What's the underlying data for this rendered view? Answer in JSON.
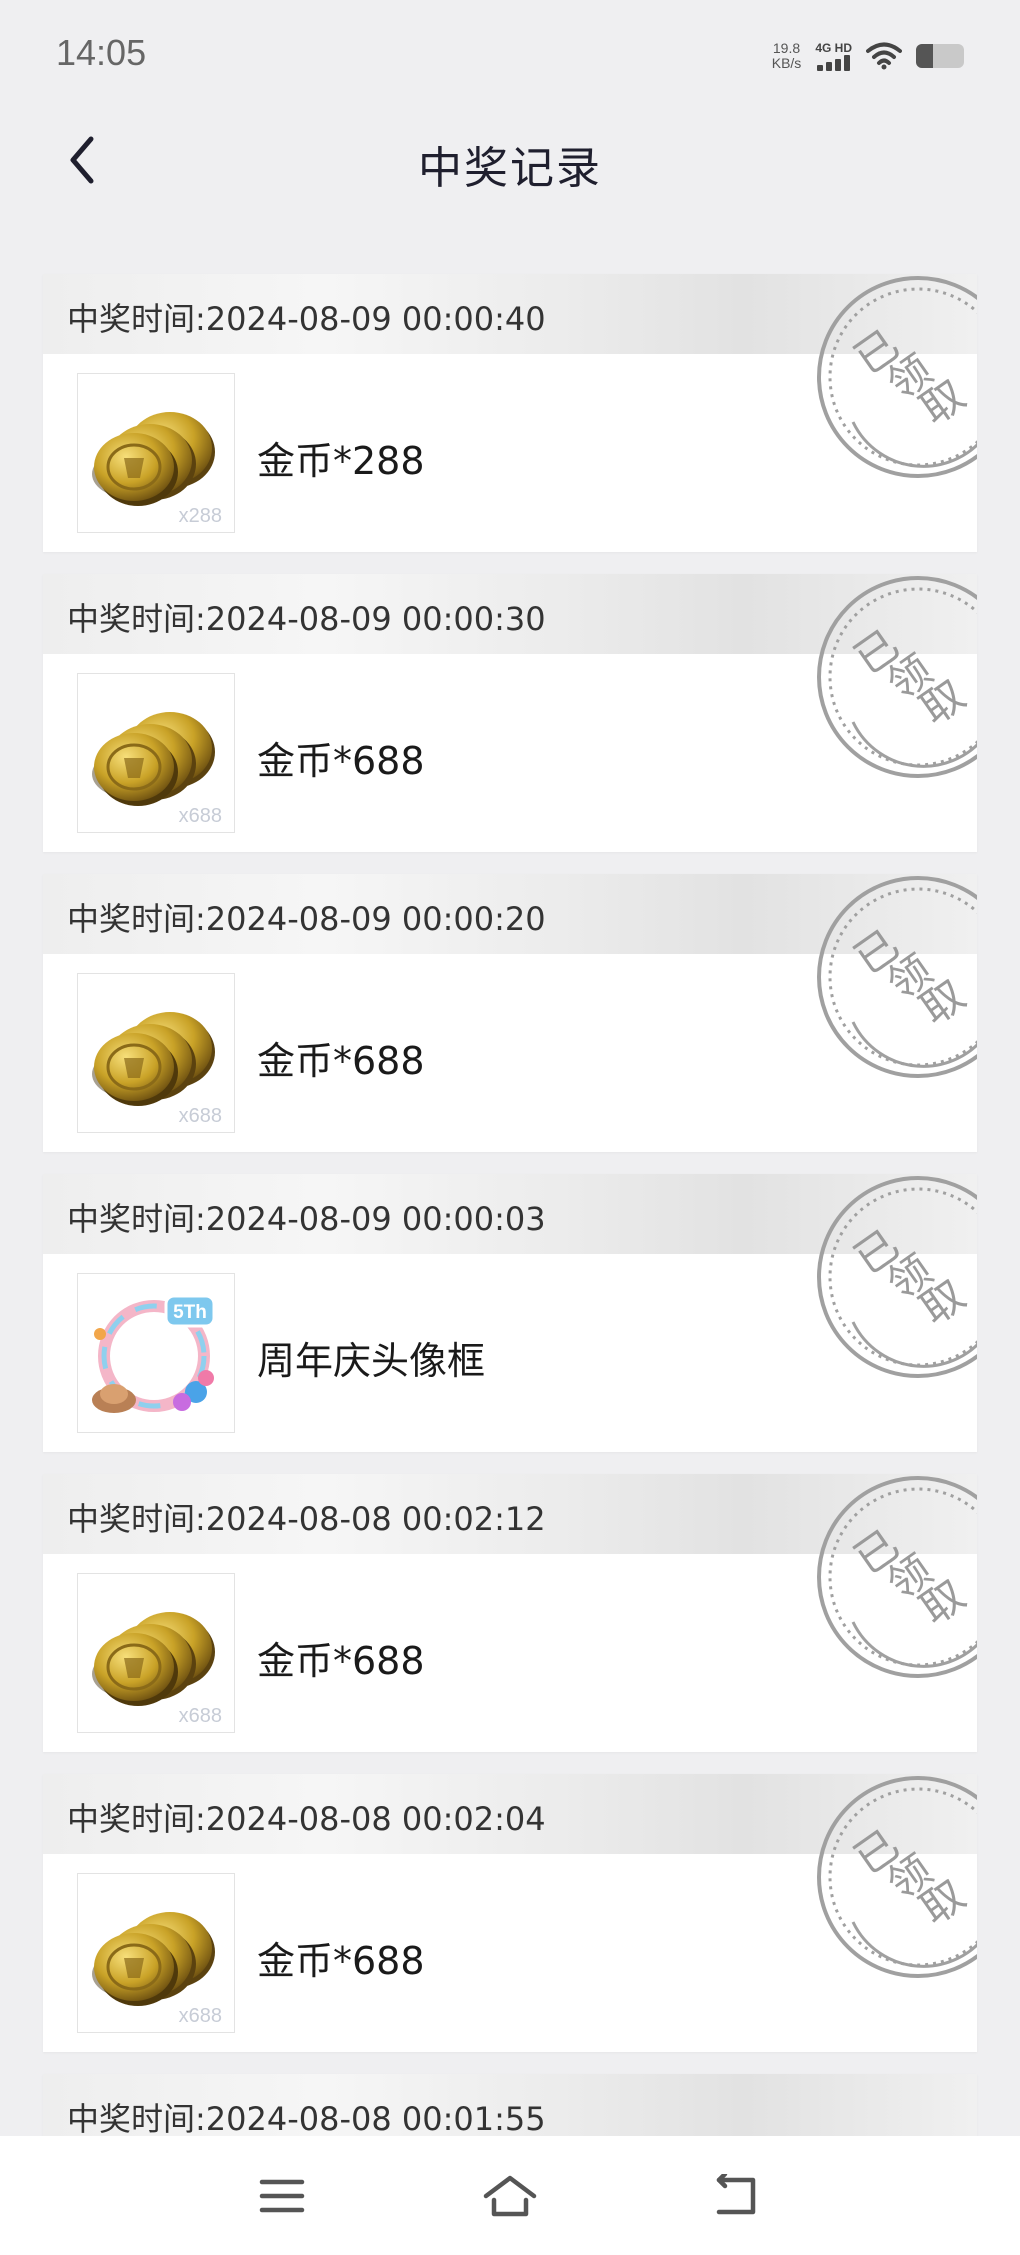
{
  "status_bar": {
    "time": "14:05",
    "speed_value": "19.8",
    "speed_unit": "KB/s",
    "network_label": "4G HD",
    "battery_level": 0.35
  },
  "header": {
    "title": "中奖记录",
    "back_icon": "chevron-left-icon"
  },
  "records": [
    {
      "time_label": "中奖时间:2024-08-09 00:00:40",
      "prize_name": "金币*288",
      "prize_type": "coins",
      "thumb_qty": "x288",
      "stamp_text": "已领取"
    },
    {
      "time_label": "中奖时间:2024-08-09 00:00:30",
      "prize_name": "金币*688",
      "prize_type": "coins",
      "thumb_qty": "x688",
      "stamp_text": "已领取"
    },
    {
      "time_label": "中奖时间:2024-08-09 00:00:20",
      "prize_name": "金币*688",
      "prize_type": "coins",
      "thumb_qty": "x688",
      "stamp_text": "已领取"
    },
    {
      "time_label": "中奖时间:2024-08-09 00:00:03",
      "prize_name": "周年庆头像框",
      "prize_type": "avatar-frame",
      "thumb_qty": "",
      "thumb_badge": "5Th",
      "stamp_text": "已领取"
    },
    {
      "time_label": "中奖时间:2024-08-08 00:02:12",
      "prize_name": "金币*688",
      "prize_type": "coins",
      "thumb_qty": "x688",
      "stamp_text": "已领取"
    },
    {
      "time_label": "中奖时间:2024-08-08 00:02:04",
      "prize_name": "金币*688",
      "prize_type": "coins",
      "thumb_qty": "x688",
      "stamp_text": "已领取"
    },
    {
      "time_label": "中奖时间:2024-08-08 00:01:55"
    }
  ],
  "nav_bar": {
    "menu_icon": "menu-icon",
    "home_icon": "home-icon",
    "back_icon": "back-icon"
  },
  "colors": {
    "background": "#efeff1",
    "card": "#ffffff",
    "stamp": "#9a9a9a",
    "coin": "#c9a227"
  }
}
